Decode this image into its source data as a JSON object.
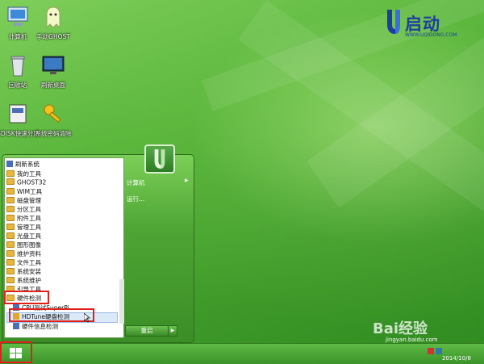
{
  "desktop": {
    "icons": [
      {
        "label": "计算机",
        "icon": "computer-icon"
      },
      {
        "label": "手动GHOST",
        "icon": "ghost-icon"
      },
      {
        "label": "回收站",
        "icon": "recycle-bin-icon"
      },
      {
        "label": "刷新桌面",
        "icon": "monitor-icon"
      },
      {
        "label": "GDISK快速分区",
        "icon": "gdisk-icon"
      },
      {
        "label": "系统密码清除",
        "icon": "key-icon"
      }
    ]
  },
  "brand": {
    "name": "启动",
    "url": "WWW.UQIDONG.COM",
    "accent": "#1c3f9e"
  },
  "start_menu": {
    "programs": [
      "刷新系统",
      "我的工具",
      "GHOST32",
      "WIM工具",
      "磁盘管理",
      "分区工具",
      "附件工具",
      "管理工具",
      "光盘工具",
      "图形图像",
      "维护资料",
      "文件工具",
      "系统安装",
      "系统维护",
      "引导工具",
      "硬件检测",
      "CPU测试SuperPi",
      "HDTune硬盘检测",
      "硬件信息检测"
    ],
    "right_items": [
      "计算机",
      "运行..."
    ],
    "shutdown_label": "重启",
    "highlight_color": "#e0201c"
  },
  "taskbar": {
    "date": "2014/10/8"
  },
  "watermark": {
    "text": "Bai经验",
    "url": "jingyan.baidu.com"
  }
}
